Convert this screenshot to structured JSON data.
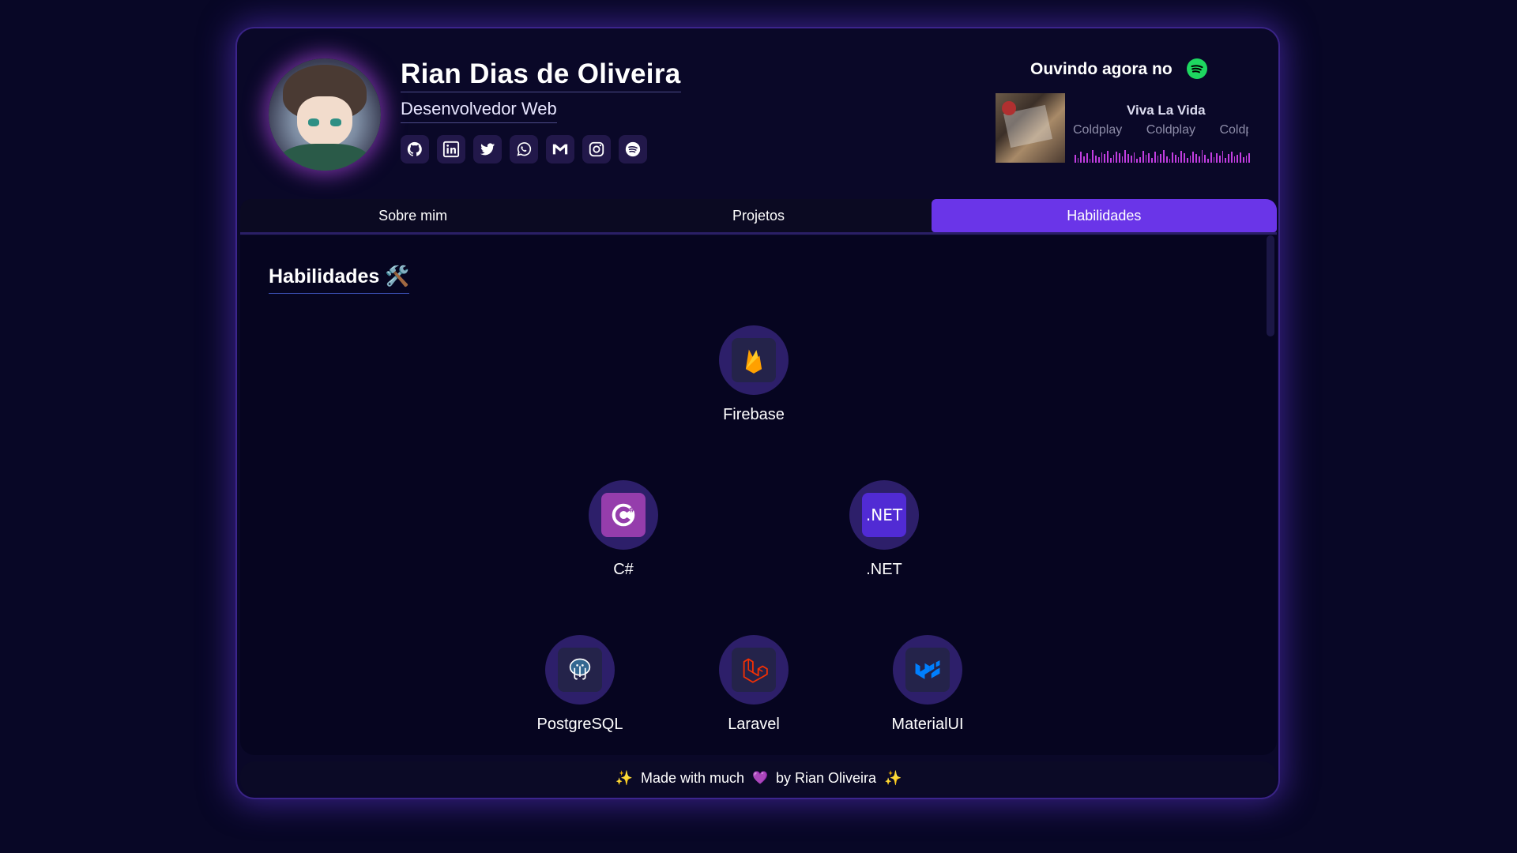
{
  "profile": {
    "name": "Rian Dias de Oliveira",
    "role": "Desenvolvedor Web",
    "socials": [
      {
        "icon": "github-icon"
      },
      {
        "icon": "linkedin-icon"
      },
      {
        "icon": "twitter-icon"
      },
      {
        "icon": "whatsapp-icon"
      },
      {
        "icon": "gmail-icon"
      },
      {
        "icon": "instagram-icon"
      },
      {
        "icon": "spotify-icon"
      }
    ]
  },
  "spotify": {
    "heading": "Ouvindo agora no",
    "song": "Viva La Vida",
    "artist": "Coldplay",
    "artist_repeat_2": "Coldplay",
    "artist_repeat_3": "Coldp"
  },
  "tabs": [
    {
      "label": "Sobre mim",
      "active": false
    },
    {
      "label": "Projetos",
      "active": false
    },
    {
      "label": "Habilidades",
      "active": true
    }
  ],
  "section": {
    "title": "Habilidades",
    "title_emoji": "🛠️"
  },
  "skills": [
    {
      "label": "Firebase",
      "icon": "firebase-icon"
    },
    {
      "label": "C#",
      "icon": "csharp-icon"
    },
    {
      "label": ".NET",
      "icon": "dotnet-icon"
    },
    {
      "label": "PostgreSQL",
      "icon": "postgresql-icon"
    },
    {
      "label": "Laravel",
      "icon": "laravel-icon"
    },
    {
      "label": "MaterialUI",
      "icon": "materialui-icon"
    }
  ],
  "footer": {
    "text_before": "Made with much",
    "text_after": "by Rian Oliveira",
    "sparkle": "✨",
    "heart": "💜"
  },
  "colors": {
    "accent": "#6a35e8",
    "background": "#080726",
    "spotify_green": "#1ed760"
  }
}
